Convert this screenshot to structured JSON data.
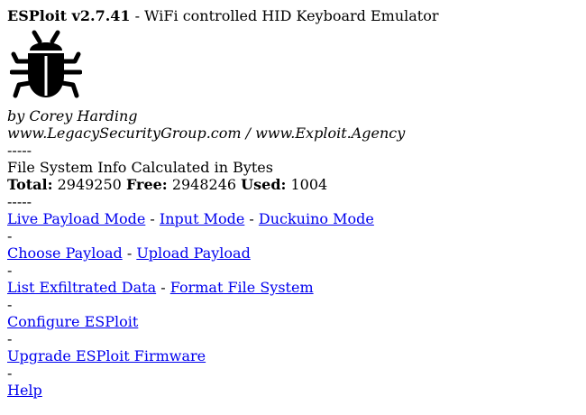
{
  "header": {
    "app_name": "ESPloit v2.7.41",
    "separator": " - ",
    "subtitle": "WiFi controlled HID Keyboard Emulator"
  },
  "logo": {
    "icon": "bug-icon",
    "color": "#000000"
  },
  "credits": {
    "author": "by Corey Harding",
    "sites": "www.LegacySecurityGroup.com / www.Exploit.Agency"
  },
  "divider": "-----",
  "filesystem": {
    "heading": "File System Info Calculated in Bytes",
    "total_label": "Total:",
    "total_value": "2949250",
    "free_label": "Free:",
    "free_value": "2948246",
    "used_label": "Used:",
    "used_value": "1004"
  },
  "link_separator": " - ",
  "row_separator": "-",
  "links": {
    "live_payload_mode": "Live Payload Mode",
    "input_mode": "Input Mode",
    "duckuino_mode": "Duckuino Mode",
    "choose_payload": "Choose Payload",
    "upload_payload": "Upload Payload",
    "list_exfiltrated_data": "List Exfiltrated Data",
    "format_file_system": "Format File System",
    "configure_esploit": "Configure ESPloit",
    "upgrade_firmware": "Upgrade ESPloit Firmware",
    "help": "Help"
  },
  "colors": {
    "link": "#0000ee",
    "text": "#000000",
    "background": "#ffffff"
  }
}
